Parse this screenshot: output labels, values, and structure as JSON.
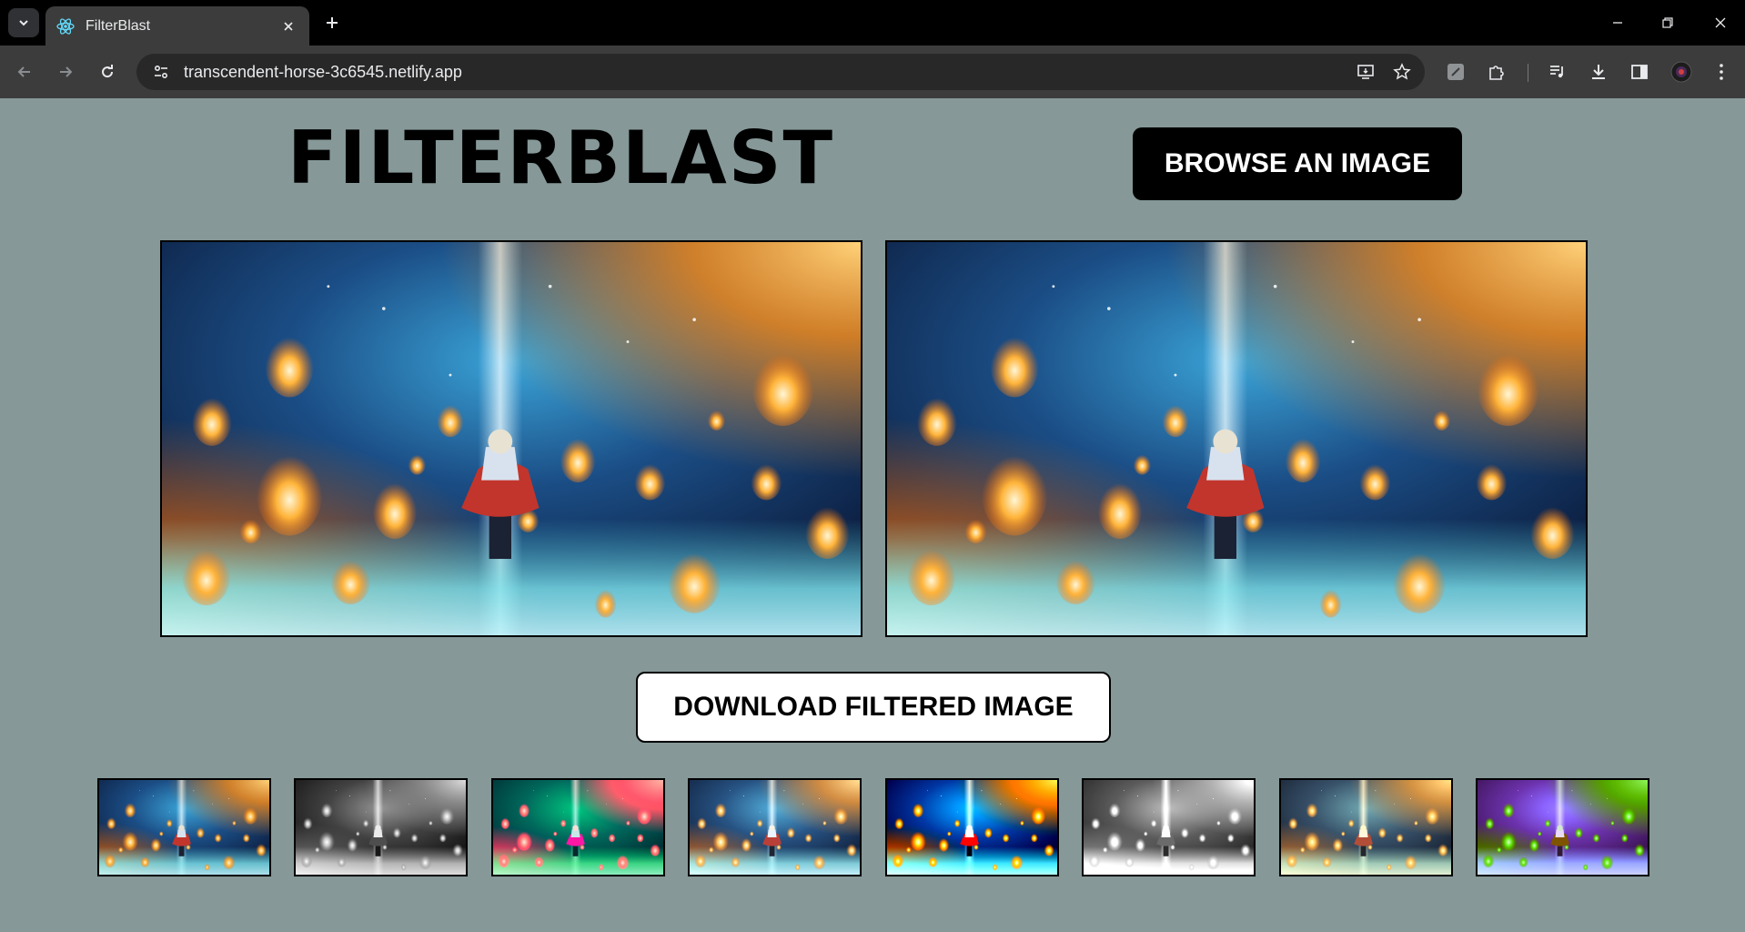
{
  "browser": {
    "tab_title": "FilterBlast",
    "url": "transcendent-horse-3c6545.netlify.app"
  },
  "app": {
    "title": "FILTERBLAST",
    "browse_label": "BROWSE AN IMAGE",
    "download_label": "DOWNLOAD FILTERED IMAGE"
  },
  "colors": {
    "page_bg": "#869898",
    "browse_bg": "#000000",
    "download_bg": "#ffffff"
  },
  "filters": [
    {
      "name": "original"
    },
    {
      "name": "grayscale"
    },
    {
      "name": "warm"
    },
    {
      "name": "soft"
    },
    {
      "name": "contrast"
    },
    {
      "name": "bright-gray"
    },
    {
      "name": "sepia"
    },
    {
      "name": "purple"
    }
  ]
}
